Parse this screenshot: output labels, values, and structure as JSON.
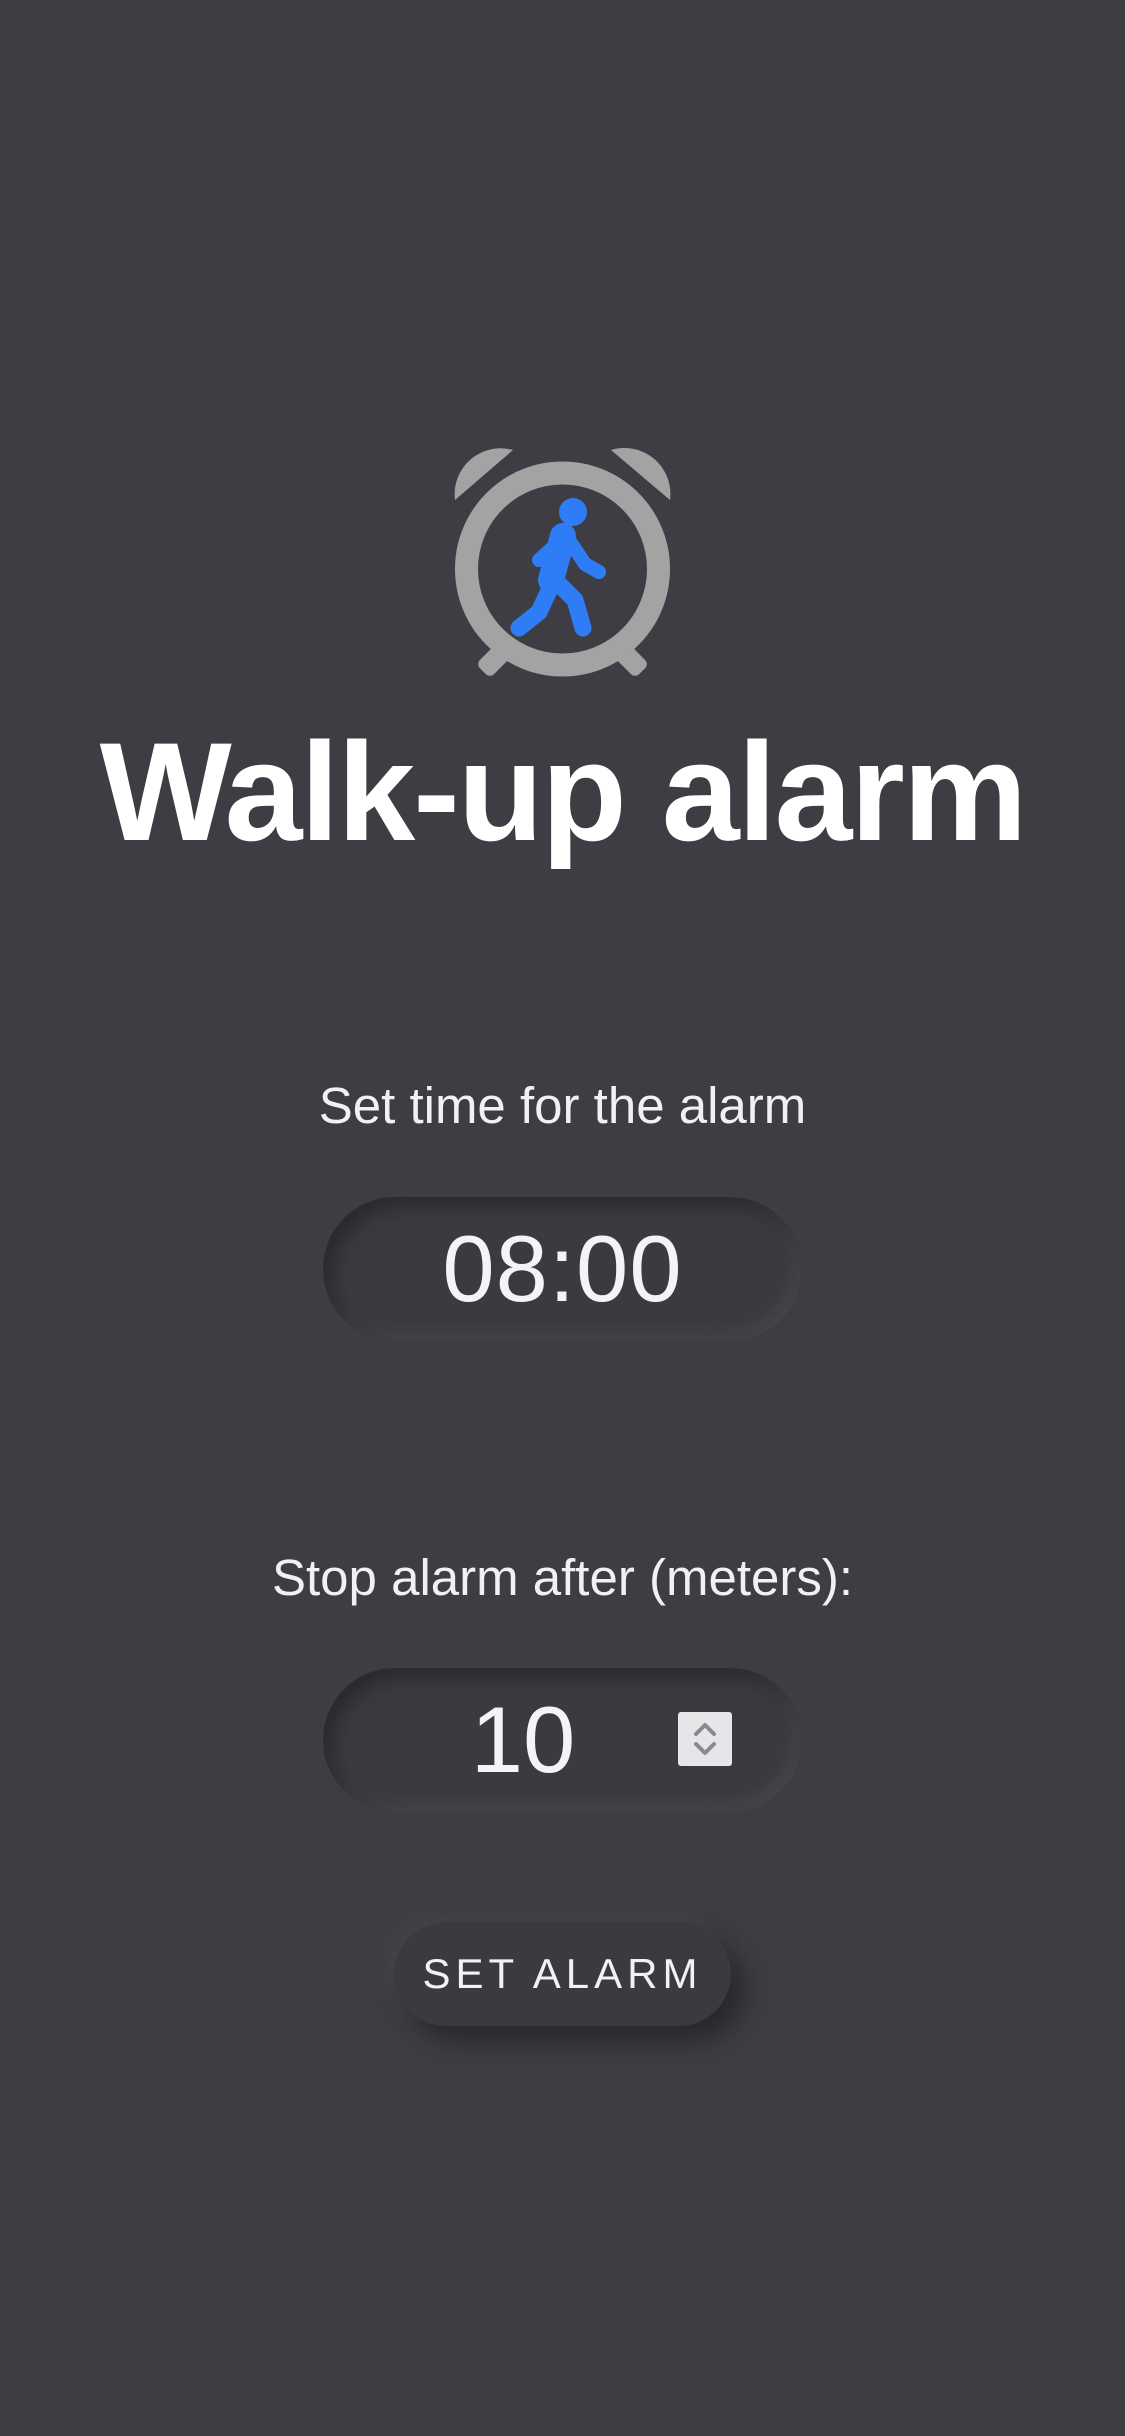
{
  "app": {
    "title": "Walk-up alarm",
    "logo_icon": "alarm-clock-walking-icon"
  },
  "time_section": {
    "label": "Set time for the alarm",
    "value": "08:00"
  },
  "distance_section": {
    "label": "Stop alarm after (meters):",
    "value": "10",
    "stepper_icon": "up-down-stepper-icon"
  },
  "actions": {
    "set_alarm_label": "SET ALARM"
  },
  "colors": {
    "background": "#3e3d43",
    "accent": "#2f7df6",
    "icon_gray": "#a3a3a3"
  }
}
